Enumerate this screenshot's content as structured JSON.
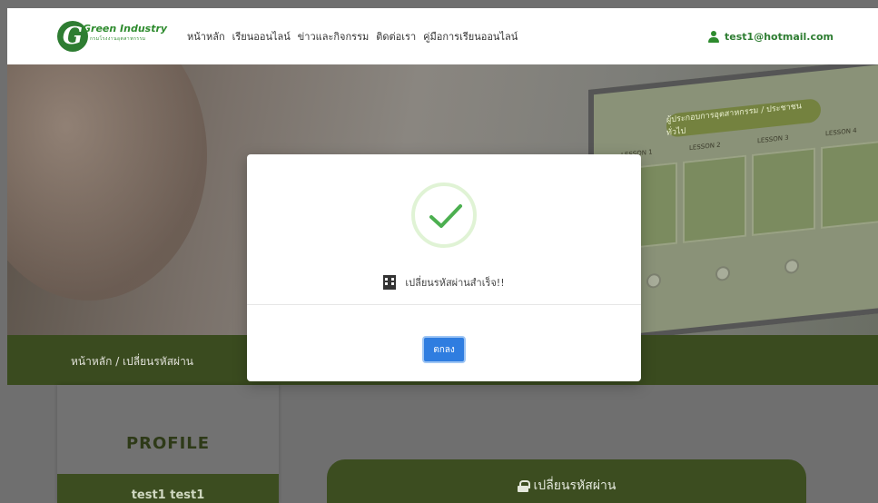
{
  "navbar": {
    "logo_title": "Green Industry",
    "logo_subtitle": "กรมโรงงานอุตสาหกรรม",
    "menu": [
      {
        "label": "หน้าหลัก"
      },
      {
        "label": "เรียนออนไลน์"
      },
      {
        "label": "ข่าวและกิจกรรม"
      },
      {
        "label": "ติดต่อเรา"
      },
      {
        "label": "คู่มือการเรียนออนไลน์"
      }
    ],
    "user_email": "test1@hotmail.com"
  },
  "hero": {
    "screen_title": "ผู้ประกอบการอุตสาหกรรม / ประชาชนทั่วไป",
    "lessons": [
      "LESSON 1",
      "LESSON 2",
      "LESSON 3",
      "LESSON 4"
    ]
  },
  "breadcrumb": {
    "text": "หน้าหลัก  /  เปลี่ยนรหัสผ่าน"
  },
  "profile": {
    "title": "PROFILE",
    "name": "test1 test1"
  },
  "change_password": {
    "title": "เปลี่ยนรหัสผ่าน"
  },
  "modal": {
    "message": "เปลี่ยนรหัสผ่านสำเร็จ!!",
    "ok_label": "ตกลง",
    "success_color": "#4caf50"
  }
}
